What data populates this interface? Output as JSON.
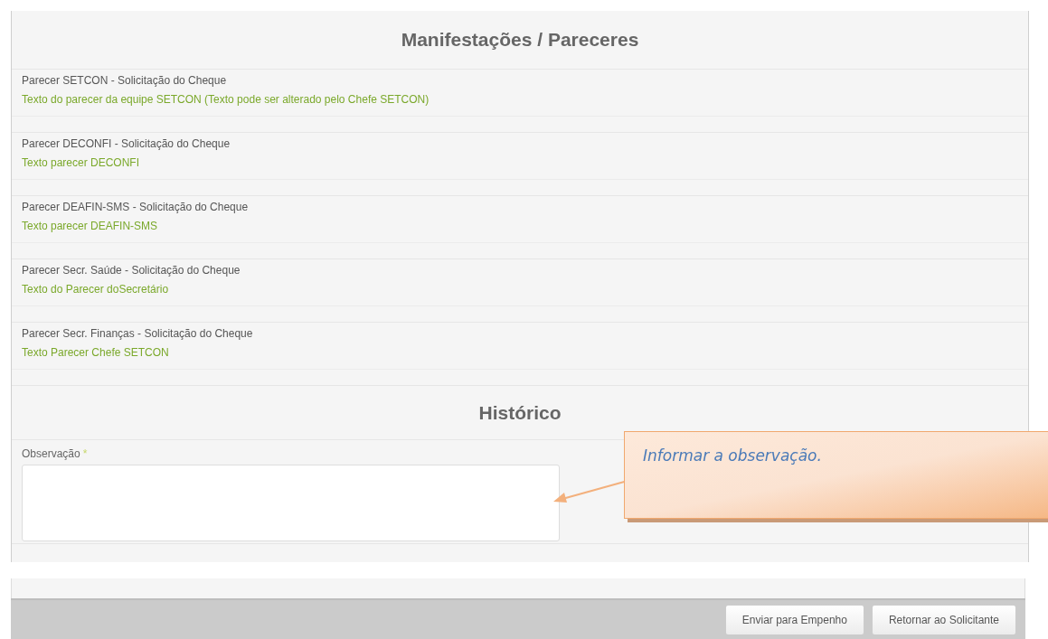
{
  "sections": [
    {
      "title": "Manifestações / Pareceres"
    }
  ],
  "pareceres": [
    {
      "label": "Parecer SETCON - Solicitação do Cheque",
      "text": "Texto do parecer da equipe SETCON (Texto pode ser alterado pelo Chefe SETCON)"
    },
    {
      "label": "Parecer DECONFI - Solicitação do Cheque",
      "text": "Texto parecer DECONFI"
    },
    {
      "label": "Parecer DEAFIN-SMS - Solicitação do Cheque",
      "text": "Texto parecer DEAFIN-SMS"
    },
    {
      "label": "Parecer Secr. Saúde - Solicitação do Cheque",
      "text": "Texto do Parecer doSecretário"
    },
    {
      "label": "Parecer Secr. Finanças - Solicitação do Cheque",
      "text": "Texto Parecer Chefe SETCON"
    }
  ],
  "historico": {
    "title": "Histórico",
    "field": {
      "label": "Observação",
      "required_mark": "*"
    }
  },
  "callout": {
    "text": "Informar a observação."
  },
  "buttons": [
    "Enviar para Empenho",
    "Retornar ao Solicitante"
  ]
}
